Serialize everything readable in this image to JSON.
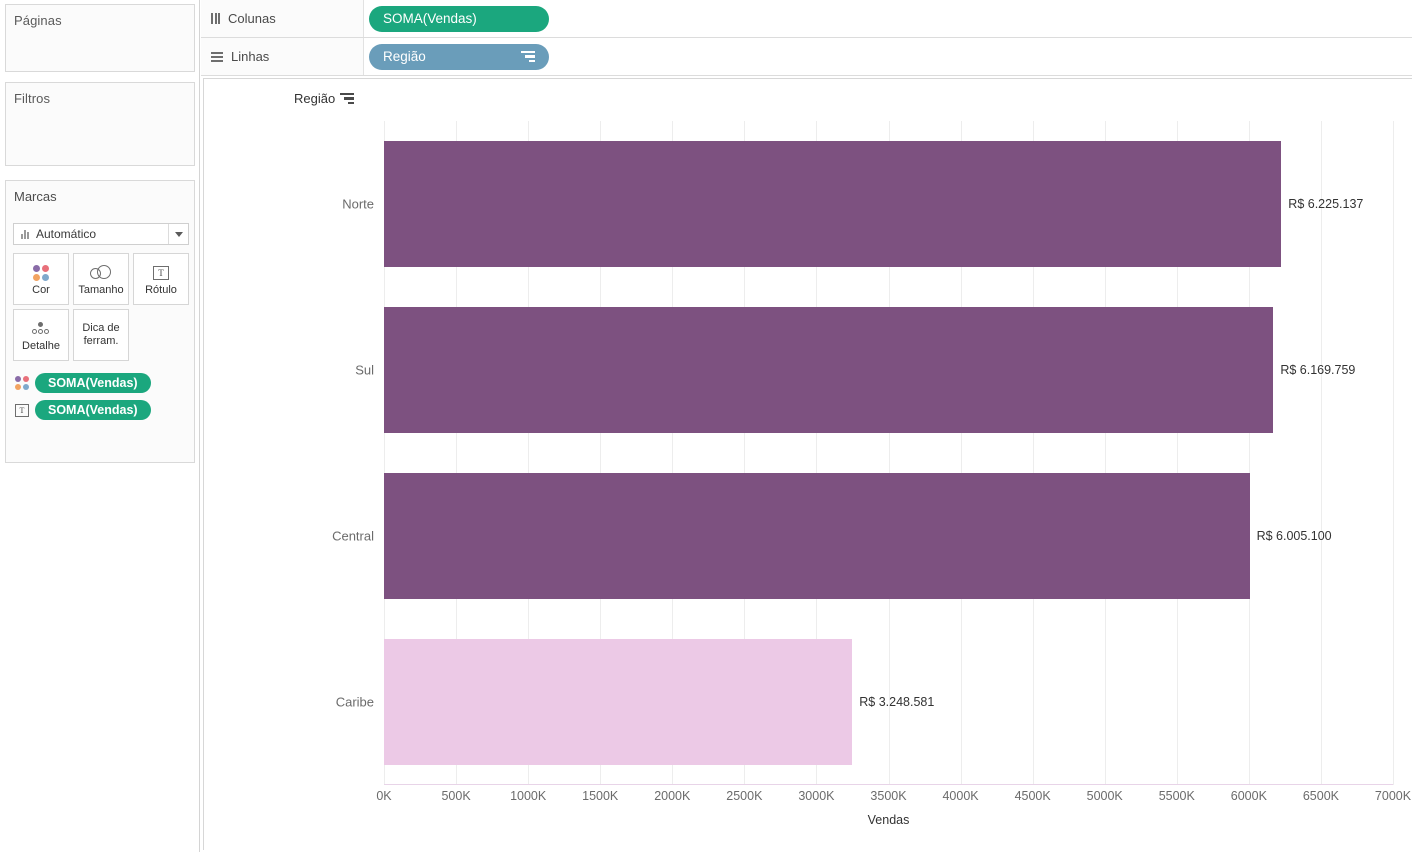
{
  "left_panel": {
    "pages": {
      "title": "Páginas"
    },
    "filters": {
      "title": "Filtros"
    },
    "marks": {
      "title": "Marcas",
      "mark_type": "Automático",
      "mark_type_icon": "bar-chart-icon",
      "dropdown_icon": "chevron-down-icon",
      "buttons": [
        {
          "label": "Cor",
          "icon": "color-dots-icon"
        },
        {
          "label": "Tamanho",
          "icon": "size-circles-icon"
        },
        {
          "label": "Rótulo",
          "icon": "text-label-icon"
        },
        {
          "label": "Detalhe",
          "icon": "detail-dots-icon"
        },
        {
          "label": "Dica de ferram.",
          "icon": "tooltip-icon"
        }
      ],
      "pills": [
        {
          "label": "SOMA(Vendas)",
          "icon": "color-dots-icon"
        },
        {
          "label": "SOMA(Vendas)",
          "icon": "text-label-icon"
        }
      ]
    }
  },
  "shelves": {
    "columns": {
      "label": "Colunas",
      "icon": "columns-icon",
      "pill": "SOMA(Vendas)",
      "pill_color": "#1ba77e"
    },
    "rows": {
      "label": "Linhas",
      "icon": "rows-icon",
      "pill": "Região",
      "pill_color": "#6a9dba",
      "pill_sort_icon": "sort-descending-icon"
    }
  },
  "view": {
    "row_field_header": "Região",
    "row_field_sort_icon": "sort-descending-icon"
  },
  "chart_data": {
    "type": "bar",
    "orientation": "horizontal",
    "title": "",
    "categories": [
      "Norte",
      "Sul",
      "Central",
      "Caribe"
    ],
    "values": [
      6225137,
      6169759,
      6005100,
      3248581
    ],
    "data_labels": [
      "R$ 6.225.137",
      "R$ 6.169.759",
      "R$ 6.005.100",
      "R$ 3.248.581"
    ],
    "colors": [
      "#7d5180",
      "#7d5180",
      "#7d5180",
      "#ecc9e6"
    ],
    "xlabel": "Vendas",
    "ylabel": "Região",
    "xlim": [
      0,
      7000000
    ],
    "x_tick_labels": [
      "0K",
      "500K",
      "1000K",
      "1500K",
      "2000K",
      "2500K",
      "3000K",
      "3500K",
      "4000K",
      "4500K",
      "5000K",
      "5500K",
      "6000K",
      "6500K",
      "7000K"
    ],
    "x_tick_values": [
      0,
      500000,
      1000000,
      1500000,
      2000000,
      2500000,
      3000000,
      3500000,
      4000000,
      4500000,
      5000000,
      5500000,
      6000000,
      6500000,
      7000000
    ],
    "grid": true,
    "legend": "none"
  }
}
